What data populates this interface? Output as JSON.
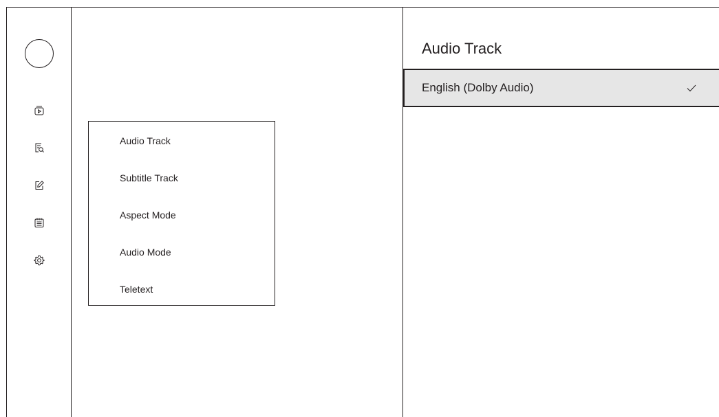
{
  "sidebar": {
    "icons": [
      "avatar",
      "play-icon",
      "search-doc-icon",
      "edit-icon",
      "calendar-icon",
      "gear-icon"
    ]
  },
  "menu": {
    "items": [
      {
        "label": "Audio Track"
      },
      {
        "label": "Subtitle Track"
      },
      {
        "label": "Aspect Mode"
      },
      {
        "label": "Audio Mode"
      },
      {
        "label": "Teletext"
      }
    ]
  },
  "panel": {
    "title": "Audio Track",
    "options": [
      {
        "label": "English (Dolby Audio)",
        "selected": true,
        "indicator": "check-icon"
      }
    ]
  },
  "colors": {
    "ink": "#231f20",
    "selected_bg": "#e6e6e6",
    "background": "#ffffff"
  }
}
